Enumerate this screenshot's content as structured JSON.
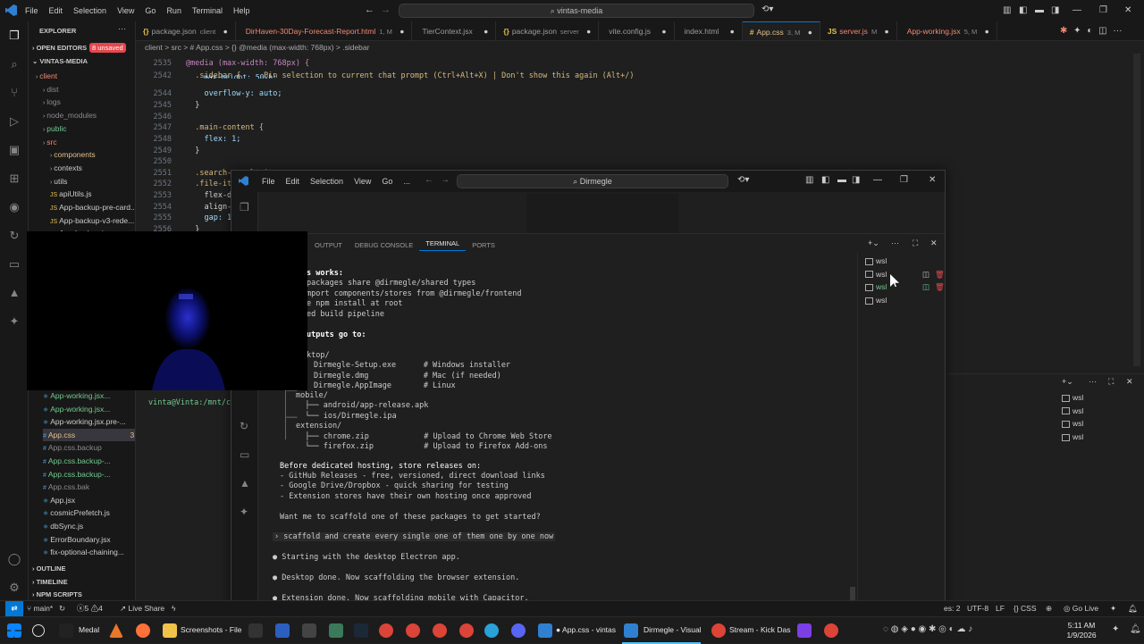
{
  "titlebar": {
    "menu": [
      "File",
      "Edit",
      "Selection",
      "View",
      "Go",
      "Run",
      "Terminal",
      "Help"
    ],
    "search": "vintas-media"
  },
  "explorer": {
    "title": "EXPLORER",
    "open_editors": "OPEN EDITORS",
    "unsaved_badge": "8 unsaved",
    "root": "VINTAS-MEDIA",
    "items": [
      {
        "label": "client",
        "color": "#f48771"
      },
      {
        "label": "dist",
        "color": "#8b8b8b"
      },
      {
        "label": "logs",
        "color": "#8b8b8b"
      },
      {
        "label": "node_modules",
        "color": "#8b8b8b"
      },
      {
        "label": "public",
        "color": "#73c991"
      },
      {
        "label": "src",
        "color": "#f48771"
      },
      {
        "label": "components",
        "color": "#e2c08d"
      },
      {
        "label": "contexts",
        "color": "#cccccc"
      },
      {
        "label": "utils",
        "color": "#cccccc"
      },
      {
        "label": "apiUtils.js",
        "color": "#cccccc"
      },
      {
        "label": "App-backup-pre-card...",
        "color": "#cccccc"
      },
      {
        "label": "App-backup-v3-rede...",
        "color": "#cccccc"
      },
      {
        "label": "App-backup.jsx",
        "color": "#cccccc"
      }
    ],
    "items_lower": [
      {
        "label": "App-working.jsx...",
        "badge": "U",
        "color": "#73c991"
      },
      {
        "label": "App-working.jsx...",
        "badge": "U",
        "color": "#73c991"
      },
      {
        "label": "App-working.jsx.pre-...",
        "badge": "",
        "color": "#cccccc"
      },
      {
        "label": "App.css",
        "badge": "3, M",
        "color": "#e2c08d"
      },
      {
        "label": "App.css.backup",
        "badge": "",
        "color": "#8b8b8b"
      },
      {
        "label": "App.css.backup-...",
        "badge": "U",
        "color": "#73c991"
      },
      {
        "label": "App.css.backup-...",
        "badge": "U",
        "color": "#73c991"
      },
      {
        "label": "App.css.bak",
        "badge": "",
        "color": "#8b8b8b"
      },
      {
        "label": "App.jsx",
        "badge": "",
        "color": "#cccccc"
      },
      {
        "label": "cosmicPrefetch.js",
        "badge": "",
        "color": "#cccccc"
      },
      {
        "label": "dbSync.js",
        "badge": "",
        "color": "#cccccc"
      },
      {
        "label": "ErrorBoundary.jsx",
        "badge": "",
        "color": "#cccccc"
      },
      {
        "label": "fix-optional-chaining...",
        "badge": "",
        "color": "#cccccc"
      }
    ],
    "outline": "OUTLINE",
    "timeline": "TIMELINE",
    "npm_scripts": "NPM SCRIPTS"
  },
  "tabs": [
    {
      "icon": "{}",
      "label": "package.json",
      "sub": "client"
    },
    {
      "icon": "",
      "label": "DirHaven-30Day-Forecast-Report.html",
      "sub": "1, M"
    },
    {
      "icon": "",
      "label": "TierContext.jsx",
      "sub": ""
    },
    {
      "icon": "{}",
      "label": "package.json",
      "sub": "server"
    },
    {
      "icon": "",
      "label": "vite.config.js",
      "sub": ""
    },
    {
      "icon": "",
      "label": "index.html",
      "sub": ""
    },
    {
      "icon": "#",
      "label": "App.css",
      "sub": "3, M"
    },
    {
      "icon": "JS",
      "label": "server.js",
      "sub": "M"
    },
    {
      "icon": "",
      "label": "App-working.jsx",
      "sub": "5, M"
    }
  ],
  "breadcrumb": "client > src > # App.css > {} @media (max-width: 768px) > .sidebar",
  "editor_lines": [
    {
      "n": "2535",
      "t": "@media (max-width: 768px) {"
    },
    {
      "n": "2542",
      "t": "  .sidebar {     Pin selection to current chat prompt (Ctrl+Alt+X) | Don't show this again (Alt+/)"
    },
    {
      "n": "2544",
      "t": "    overflow-y: auto;"
    },
    {
      "n": "2545",
      "t": "  }"
    },
    {
      "n": "2546",
      "t": ""
    },
    {
      "n": "2547",
      "t": "  .main-content {"
    },
    {
      "n": "2548",
      "t": "    flex: 1;"
    },
    {
      "n": "2549",
      "t": "  }"
    },
    {
      "n": "2550",
      "t": ""
    },
    {
      "n": "2551",
      "t": "  .search-result-item"
    },
    {
      "n": "2552",
      "t": "  .file-it"
    },
    {
      "n": "2553",
      "t": "    flex-d"
    },
    {
      "n": "2554",
      "t": "    align-"
    },
    {
      "n": "2555",
      "t": "    gap: 1"
    },
    {
      "n": "2556",
      "t": "  }"
    }
  ],
  "editor_partial": "max-height: 50vh;",
  "win2": {
    "menu": [
      "File",
      "Edit",
      "Selection",
      "View",
      "Go",
      "..."
    ],
    "search": "Dirmegle",
    "panel_tabs": [
      "OUTPUT",
      "DEBUG CONSOLE",
      "TERMINAL",
      "PORTS"
    ],
    "terminals": [
      "wsl",
      "wsl",
      "wsl",
      "wsl"
    ],
    "terminal_lines": [
      "s works:",
      "packages share @dirmegle/shared types",
      "mport components/stores from @dirmegle/frontend",
      "e npm install at root",
      "ed build pipeline",
      "",
      "utputs go to:",
      "",
      "ktop/",
      "Dirmegle-Setup.exe      # Windows installer",
      "Dirmegle.dmg            # Mac (if needed)",
      "Dirmegle.AppImage       # Linux"
    ],
    "terminal_lines2": [
      "mobile/",
      "  ├── android/app-release.apk",
      "  └── ios/Dirmegle.ipa",
      "extension/",
      "  ├── chrome.zip            # Upload to Chrome Web Store",
      "  └── firefox.zip           # Upload to Firefox Add-ons"
    ],
    "before_hosting": "Before dedicated hosting, store releases on:",
    "bullets": [
      "- GitHub Releases - free, versioned, direct download links",
      "- Google Drive/Dropbox - quick sharing for testing",
      "- Extension stores have their own hosting once approved"
    ],
    "question": "Want me to scaffold one of these packages to get started?",
    "prompt": "scaffold and create every single one of them one by one now",
    "progress": [
      "Starting with the desktop Electron app.",
      "Desktop done. Now scaffolding the browser extension.",
      "Extension done. Now scaffolding mobile with Capacitor."
    ]
  },
  "bg_terminal_prompt": "vinta@Vinta:/mnt/c/U",
  "bg_terminals": [
    "wsl",
    "wsl",
    "wsl",
    "wsl"
  ],
  "statusbar": {
    "branch": "main*",
    "errors": "5",
    "warnings": "4",
    "live_share": "Live Share",
    "spaces": "es: 2",
    "encoding": "UTF-8",
    "eol": "LF",
    "lang": "CSS",
    "golive": "Go Live"
  },
  "taskbar": {
    "items": [
      "Medal",
      "Screenshots - File",
      "App.css - vintas",
      "Dirmegle - Visual",
      "Stream - Kick Das"
    ],
    "time": "5:11 AM",
    "date": "1/9/2026"
  },
  "colors": {
    "accent": "#0078d4",
    "modified": "#e2c08d",
    "untracked": "#73c991",
    "error": "#f48771"
  }
}
